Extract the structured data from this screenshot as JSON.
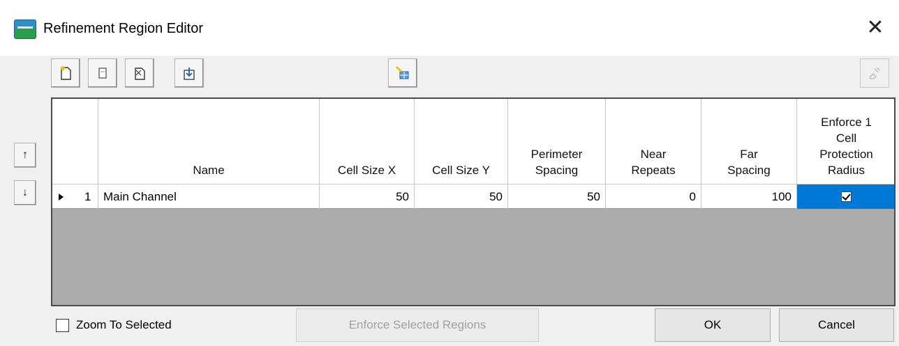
{
  "window": {
    "title": "Refinement Region Editor",
    "close_glyph": "✕",
    "app_icon": "ras-mapper-icon"
  },
  "toolbar": {
    "buttons": [
      {
        "name": "add-region-button",
        "icon": "new-document-icon",
        "enabled": true
      },
      {
        "name": "copy-region-button",
        "icon": "copy-icon",
        "enabled": true
      },
      {
        "name": "delete-region-button",
        "icon": "delete-icon",
        "enabled": true
      },
      {
        "name": "import-region-button",
        "icon": "import-icon",
        "enabled": true
      },
      {
        "name": "edit-geometry-button",
        "icon": "pencil-grid-icon",
        "enabled": true
      },
      {
        "name": "clear-button",
        "icon": "eraser-icon",
        "enabled": false
      }
    ]
  },
  "side_buttons": {
    "up": "↑",
    "down": "↓"
  },
  "table": {
    "columns": [
      "",
      "Name",
      "Cell Size X",
      "Cell Size Y",
      "Perimeter Spacing",
      "Near Repeats",
      "Far Spacing",
      "Enforce 1 Cell Protection Radius"
    ],
    "header_lines": {
      "name": [
        "Name"
      ],
      "cell_size_x": [
        "Cell Size X"
      ],
      "cell_size_y": [
        "Cell Size Y"
      ],
      "perimeter_spacing": [
        "Perimeter",
        "Spacing"
      ],
      "near_repeats": [
        "Near",
        "Repeats"
      ],
      "far_spacing": [
        "Far",
        "Spacing"
      ],
      "enforce": [
        "Enforce 1",
        "Cell",
        "Protection",
        "Radius"
      ]
    },
    "rows": [
      {
        "index": "1",
        "name": "Main Channel",
        "cell_size_x": "50",
        "cell_size_y": "50",
        "perimeter_spacing": "50",
        "near_repeats": "0",
        "far_spacing": "100",
        "enforce_protection": true
      }
    ],
    "selected_cell_color": "#0078d7"
  },
  "footer": {
    "zoom_to_selected": {
      "label": "Zoom To Selected",
      "checked": false
    },
    "enforce_button": "Enforce Selected Regions",
    "ok_button": "OK",
    "cancel_button": "Cancel"
  }
}
